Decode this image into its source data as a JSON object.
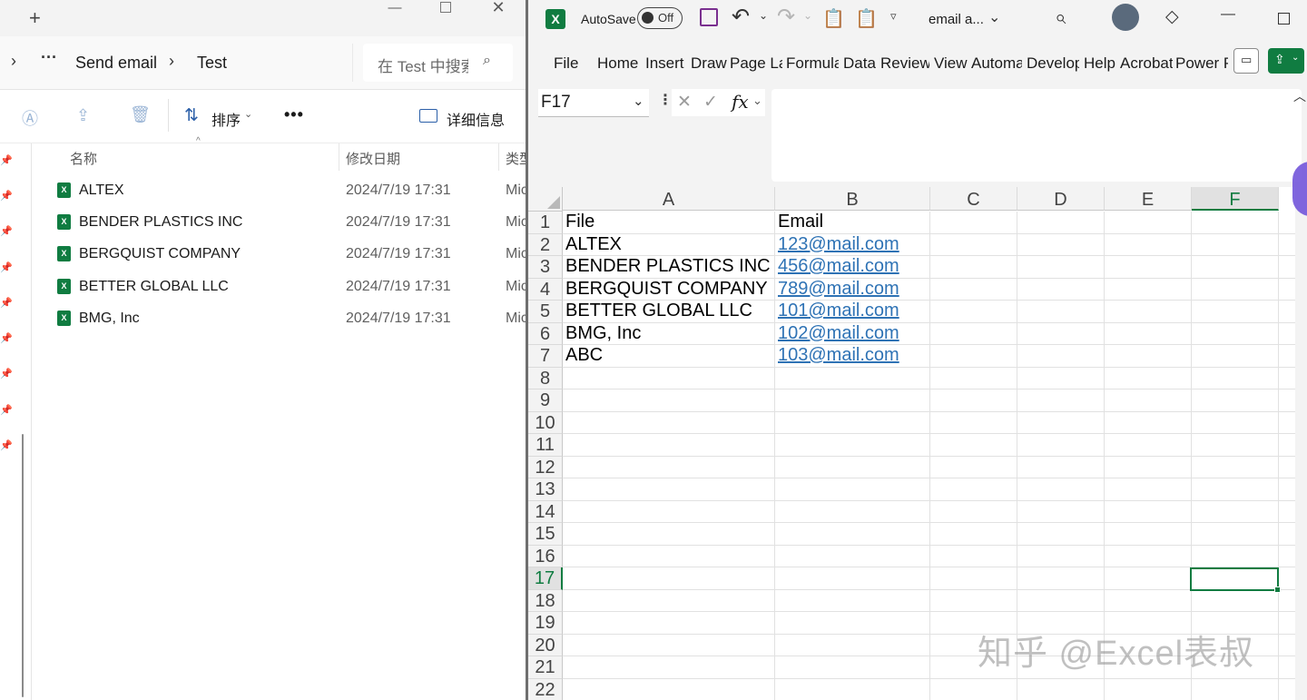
{
  "explorer": {
    "breadcrumb": [
      "Send email",
      "Test"
    ],
    "search_placeholder": "在 Test 中搜索",
    "toolbar": {
      "sort_label": "排序",
      "more_label": "•••",
      "details_label": "详细信息"
    },
    "columns": {
      "name": "名称",
      "modified": "修改日期",
      "type": "类型"
    },
    "files": [
      {
        "name": "ALTEX",
        "modified": "2024/7/19 17:31",
        "type": "Mic"
      },
      {
        "name": "BENDER PLASTICS INC",
        "modified": "2024/7/19 17:31",
        "type": "Mic"
      },
      {
        "name": "BERGQUIST COMPANY",
        "modified": "2024/7/19 17:31",
        "type": "Mic"
      },
      {
        "name": "BETTER GLOBAL LLC",
        "modified": "2024/7/19 17:31",
        "type": "Mic"
      },
      {
        "name": "BMG, Inc",
        "modified": "2024/7/19 17:31",
        "type": "Mic"
      }
    ]
  },
  "excel": {
    "autosave_label": "AutoSave",
    "autosave_state": "Off",
    "file_title": "email a...",
    "ribbon_tabs": [
      "File",
      "Home",
      "Insert",
      "Draw",
      "Page La",
      "Formula",
      "Data",
      "Review",
      "View",
      "Automa",
      "Develop",
      "Help",
      "Acrobat",
      "Power P"
    ],
    "name_box": "F17",
    "fx_label": "fx",
    "columns": [
      "A",
      "B",
      "C",
      "D",
      "E",
      "F"
    ],
    "rows": [
      {
        "n": "1",
        "a": "File",
        "b": "Email"
      },
      {
        "n": "2",
        "a": "ALTEX",
        "b": "123@mail.com"
      },
      {
        "n": "3",
        "a": "BENDER PLASTICS INC",
        "b": "456@mail.com"
      },
      {
        "n": "4",
        "a": "BERGQUIST COMPANY",
        "b": "789@mail.com"
      },
      {
        "n": "5",
        "a": "BETTER GLOBAL LLC",
        "b": "101@mail.com"
      },
      {
        "n": "6",
        "a": "BMG, Inc",
        "b": "102@mail.com"
      },
      {
        "n": "7",
        "a": "ABC",
        "b": "103@mail.com"
      },
      {
        "n": "8",
        "a": "",
        "b": ""
      },
      {
        "n": "9",
        "a": "",
        "b": ""
      },
      {
        "n": "10",
        "a": "",
        "b": ""
      },
      {
        "n": "11",
        "a": "",
        "b": ""
      },
      {
        "n": "12",
        "a": "",
        "b": ""
      },
      {
        "n": "13",
        "a": "",
        "b": ""
      },
      {
        "n": "14",
        "a": "",
        "b": ""
      },
      {
        "n": "15",
        "a": "",
        "b": ""
      },
      {
        "n": "16",
        "a": "",
        "b": ""
      },
      {
        "n": "17",
        "a": "",
        "b": ""
      },
      {
        "n": "18",
        "a": "",
        "b": ""
      },
      {
        "n": "19",
        "a": "",
        "b": ""
      },
      {
        "n": "20",
        "a": "",
        "b": ""
      },
      {
        "n": "21",
        "a": "",
        "b": ""
      },
      {
        "n": "22",
        "a": "",
        "b": ""
      }
    ],
    "selected_row": "17",
    "selected_column": "F",
    "accent_color": "#107c41",
    "link_color": "#2f73b5"
  },
  "watermark": "知乎 @Excel表叔"
}
